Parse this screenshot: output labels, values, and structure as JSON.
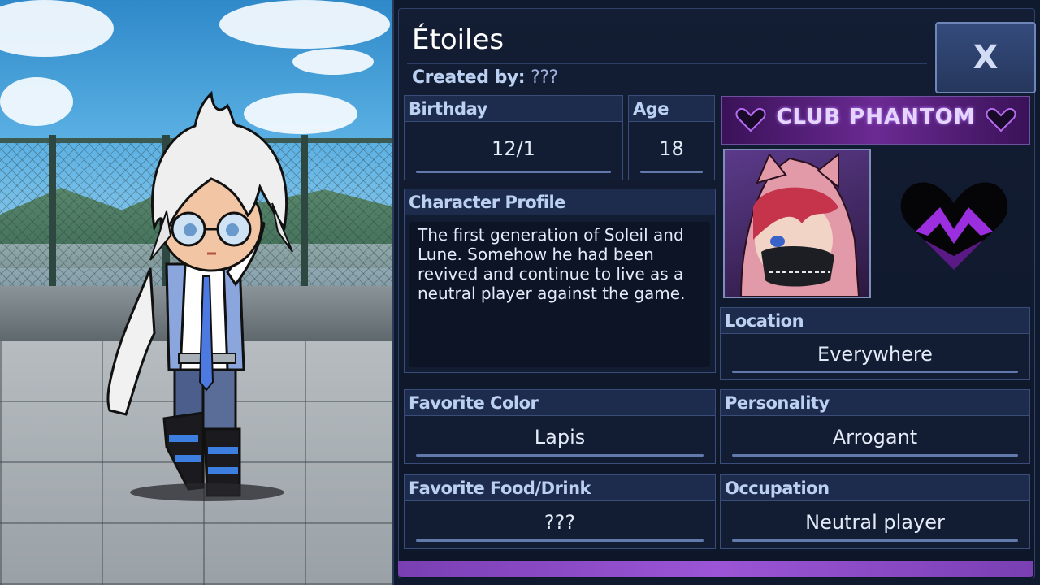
{
  "panel": {
    "title": "Étoiles",
    "created_by_label": "Created by:",
    "created_by_value": "???",
    "close_label": "X"
  },
  "fields": {
    "birthday": {
      "label": "Birthday",
      "value": "12/1"
    },
    "age": {
      "label": "Age",
      "value": "18"
    },
    "profile": {
      "label": "Character Profile",
      "value": "The first generation of Soleil and Lune. Somehow he had been revived and continue to live as a neutral player against the game."
    },
    "location": {
      "label": "Location",
      "value": "Everywhere"
    },
    "favorite_color": {
      "label": "Favorite Color",
      "value": "Lapis"
    },
    "personality": {
      "label": "Personality",
      "value": "Arrogant"
    },
    "favorite_food": {
      "label": "Favorite Food/Drink",
      "value": "???"
    },
    "occupation": {
      "label": "Occupation",
      "value": "Neutral player"
    }
  },
  "banner": {
    "text": "CLUB PHANTOM"
  },
  "colors": {
    "panel_bg": "#0f1a2e",
    "label_bg": "#1d2c4d",
    "label_text": "#bcd1f2",
    "accent_purple": "#9b55d6"
  }
}
